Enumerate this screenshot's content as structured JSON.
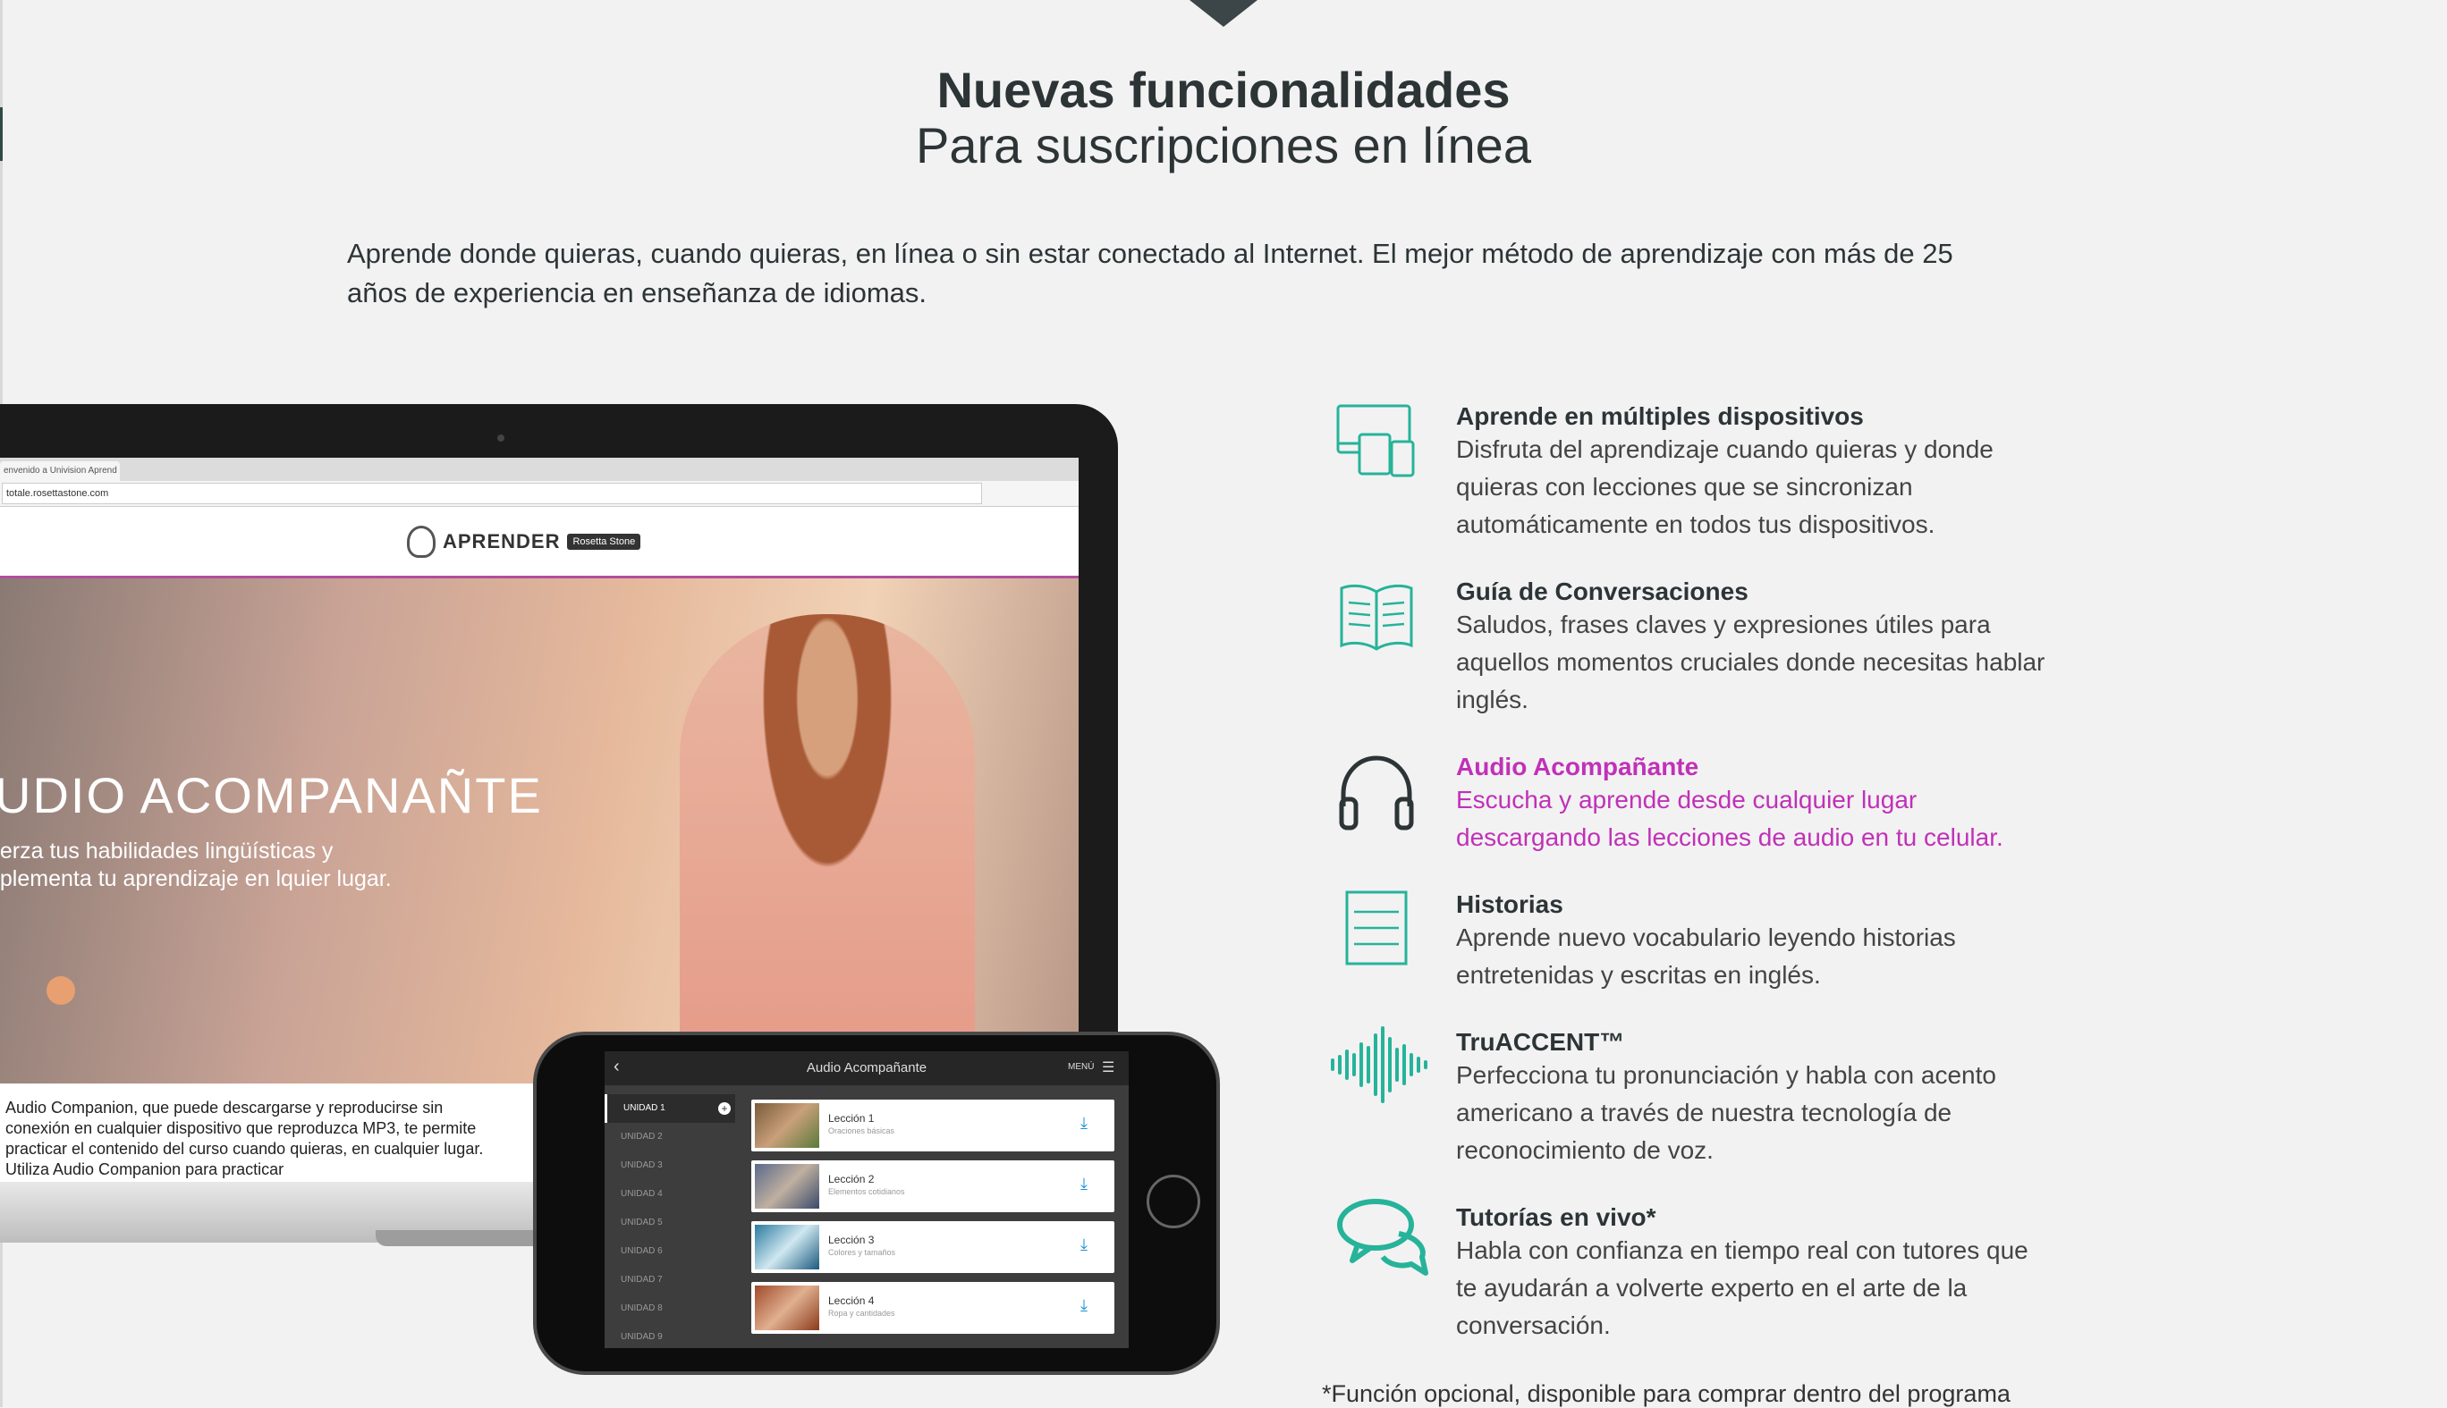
{
  "header": {
    "title": "Nuevas funcionalidades",
    "subtitle": "Para suscripciones en línea"
  },
  "intro": "Aprende donde quieras, cuando quieras, en línea o sin estar conectado al Internet. El mejor método de aprendizaje con más de 25 años de experiencia en enseñanza de idiomas.",
  "laptop": {
    "tab": "envenido a Univision Aprend",
    "url": "totale.rosettastone.com",
    "logo_text": "APRENDER",
    "logo_brand": "Rosetta Stone",
    "hero_title": "UDIO ACOMPANAÑTE",
    "hero_text": "uerza tus habilidades lingüísticas y nplementa tu aprendizaje en lquier lugar.",
    "description": "Audio Companion, que puede descargarse y reproducirse sin conexión en cualquier dispositivo que reproduzca MP3, te permite practicar el contenido del curso cuando quieras, en cualquier lugar. Utiliza Audio Companion para practicar"
  },
  "phone": {
    "title": "Audio Acompañante",
    "menu": "MENÚ",
    "units": [
      "UNIDAD 1",
      "UNIDAD 2",
      "UNIDAD 3",
      "UNIDAD 4",
      "UNIDAD 5",
      "UNIDAD 6",
      "UNIDAD 7",
      "UNIDAD 8",
      "UNIDAD 9"
    ],
    "lessons": [
      {
        "name": "Lección 1",
        "sub": "Oraciones básicas"
      },
      {
        "name": "Lección 2",
        "sub": "Elementos cotidianos"
      },
      {
        "name": "Lección 3",
        "sub": "Colores y tamaños"
      },
      {
        "name": "Lección 4",
        "sub": "Ropa y cantidades"
      }
    ]
  },
  "features": [
    {
      "icon": "devices-icon",
      "title": "Aprende en múltiples dispositivos",
      "desc": "Disfruta del aprendizaje cuando quieras y donde quieras con lecciones que se sincronizan automáticamente en todos tus dispositivos."
    },
    {
      "icon": "book-icon",
      "title": "Guía de Conversaciones",
      "desc": "Saludos, frases claves y expresiones útiles para aquellos momentos cruciales donde necesitas hablar inglés."
    },
    {
      "icon": "headphones-icon",
      "title": "Audio Acompañante",
      "desc": "Escucha y aprende desde cualquier lugar descargando las lecciones de audio en tu celular."
    },
    {
      "icon": "document-icon",
      "title": "Historias",
      "desc": "Aprende nuevo vocabulario leyendo historias entretenidas y escritas en inglés."
    },
    {
      "icon": "waveform-icon",
      "title": "TruACCENT™",
      "desc": "Perfecciona tu pronunciación y habla con acento americano a través de nuestra tecnología de reconocimiento de voz."
    },
    {
      "icon": "chat-bubbles-icon",
      "title": "Tutorías en vivo*",
      "desc": "Habla con confianza en tiempo real con tutores que te ayudarán a volverte experto en el arte de la conversación."
    }
  ],
  "colors": {
    "accent": "#26b39a",
    "highlight": "#c031b8",
    "heading": "#2c3436"
  },
  "footnote": "*Función opcional, disponible para comprar dentro del programa"
}
